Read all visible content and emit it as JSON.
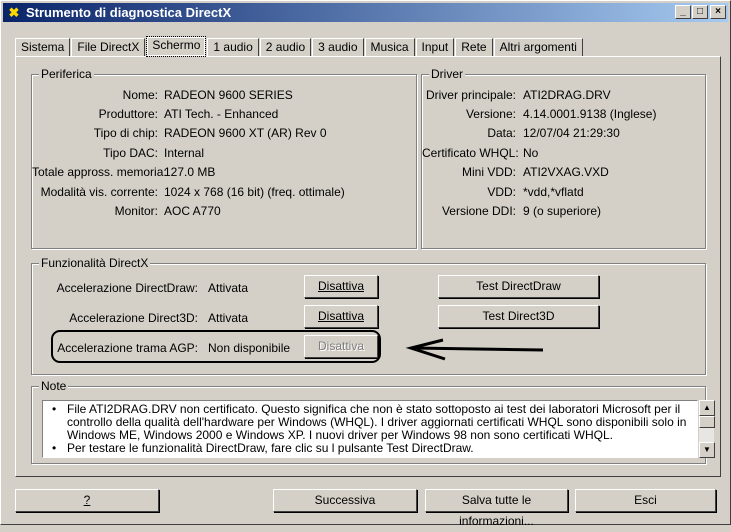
{
  "window": {
    "title": "Strumento di diagnostica DirectX"
  },
  "tabs": [
    "Sistema",
    "File DirectX",
    "Schermo",
    "1 audio",
    "2 audio",
    "3 audio",
    "Musica",
    "Input",
    "Rete",
    "Altri argomenti"
  ],
  "device": {
    "title": "Periferica",
    "fields": [
      {
        "label": "Nome:",
        "value": "RADEON 9600 SERIES"
      },
      {
        "label": "Produttore:",
        "value": "ATI Tech. - Enhanced"
      },
      {
        "label": "Tipo di chip:",
        "value": "RADEON 9600 XT (AR) Rev 0"
      },
      {
        "label": "Tipo DAC:",
        "value": "Internal"
      },
      {
        "label": "Totale appross. memoria:",
        "value": "127.0 MB"
      },
      {
        "label": "Modalità vis. corrente:",
        "value": "1024 x 768 (16 bit) (freq. ottimale)"
      },
      {
        "label": "Monitor:",
        "value": "AOC A770"
      }
    ]
  },
  "driver": {
    "title": "Driver",
    "fields": [
      {
        "label": "Driver principale:",
        "value": "ATI2DRAG.DRV"
      },
      {
        "label": "Versione:",
        "value": "4.14.0001.9138 (Inglese)"
      },
      {
        "label": "Data:",
        "value": "12/07/04 21:29:30"
      },
      {
        "label": "Certificato WHQL:",
        "value": "No"
      },
      {
        "label": "Mini VDD:",
        "value": "ATI2VXAG.VXD"
      },
      {
        "label": "VDD:",
        "value": "*vdd,*vflatd"
      },
      {
        "label": "Versione DDI:",
        "value": "9 (o superiore)"
      }
    ]
  },
  "features": {
    "title": "Funzionalità DirectX",
    "rows": [
      {
        "label": "Accelerazione DirectDraw:",
        "status": "Attivata",
        "button": "Disattiva"
      },
      {
        "label": "Accelerazione Direct3D:",
        "status": "Attivata",
        "button": "Disattiva"
      },
      {
        "label": "Accelerazione trama AGP:",
        "status": "Non disponibile",
        "button": "Disattiva"
      }
    ],
    "test_directdraw": "Test DirectDraw",
    "test_direct3d": "Test Direct3D"
  },
  "notes": {
    "title": "Note",
    "items": [
      "File ATI2DRAG.DRV non certificato. Questo significa che non è stato sottoposto ai test dei laboratori Microsoft per il controllo della qualità dell'hardware per Windows (WHQL). I driver aggiornati certificati WHQL sono disponibili solo in Windows ME, Windows 2000 e Windows XP. I nuovi driver per Windows 98 non sono certificati WHQL.",
      "Per testare le funzionalità DirectDraw, fare clic su l pulsante Test DirectDraw."
    ]
  },
  "footer": {
    "help": "?",
    "next": "Successiva",
    "save": "Salva tutte le informazioni...",
    "exit": "Esci"
  }
}
